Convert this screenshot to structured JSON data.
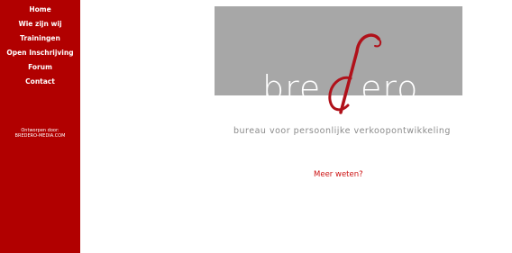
{
  "sidebar": {
    "nav": [
      {
        "label": "Home"
      },
      {
        "label": "Wie zijn wij"
      },
      {
        "label": "Trainingen"
      },
      {
        "label": "Open Inschrijving"
      },
      {
        "label": "Forum"
      },
      {
        "label": "Contact"
      }
    ],
    "credit": {
      "designed_by": "Ontworpen door:",
      "link": "BREDERO-MEDIA.COM"
    }
  },
  "logo": {
    "text": "bredero"
  },
  "tagline": "bureau voor persoonlijke verkoopontwikkeling",
  "more_link": "Meer weten?",
  "colors": {
    "sidebar_bg": "#b10000",
    "logo_box": "#a7a7a7",
    "accent": "#cc1111",
    "tagline": "#8a8a8a"
  }
}
